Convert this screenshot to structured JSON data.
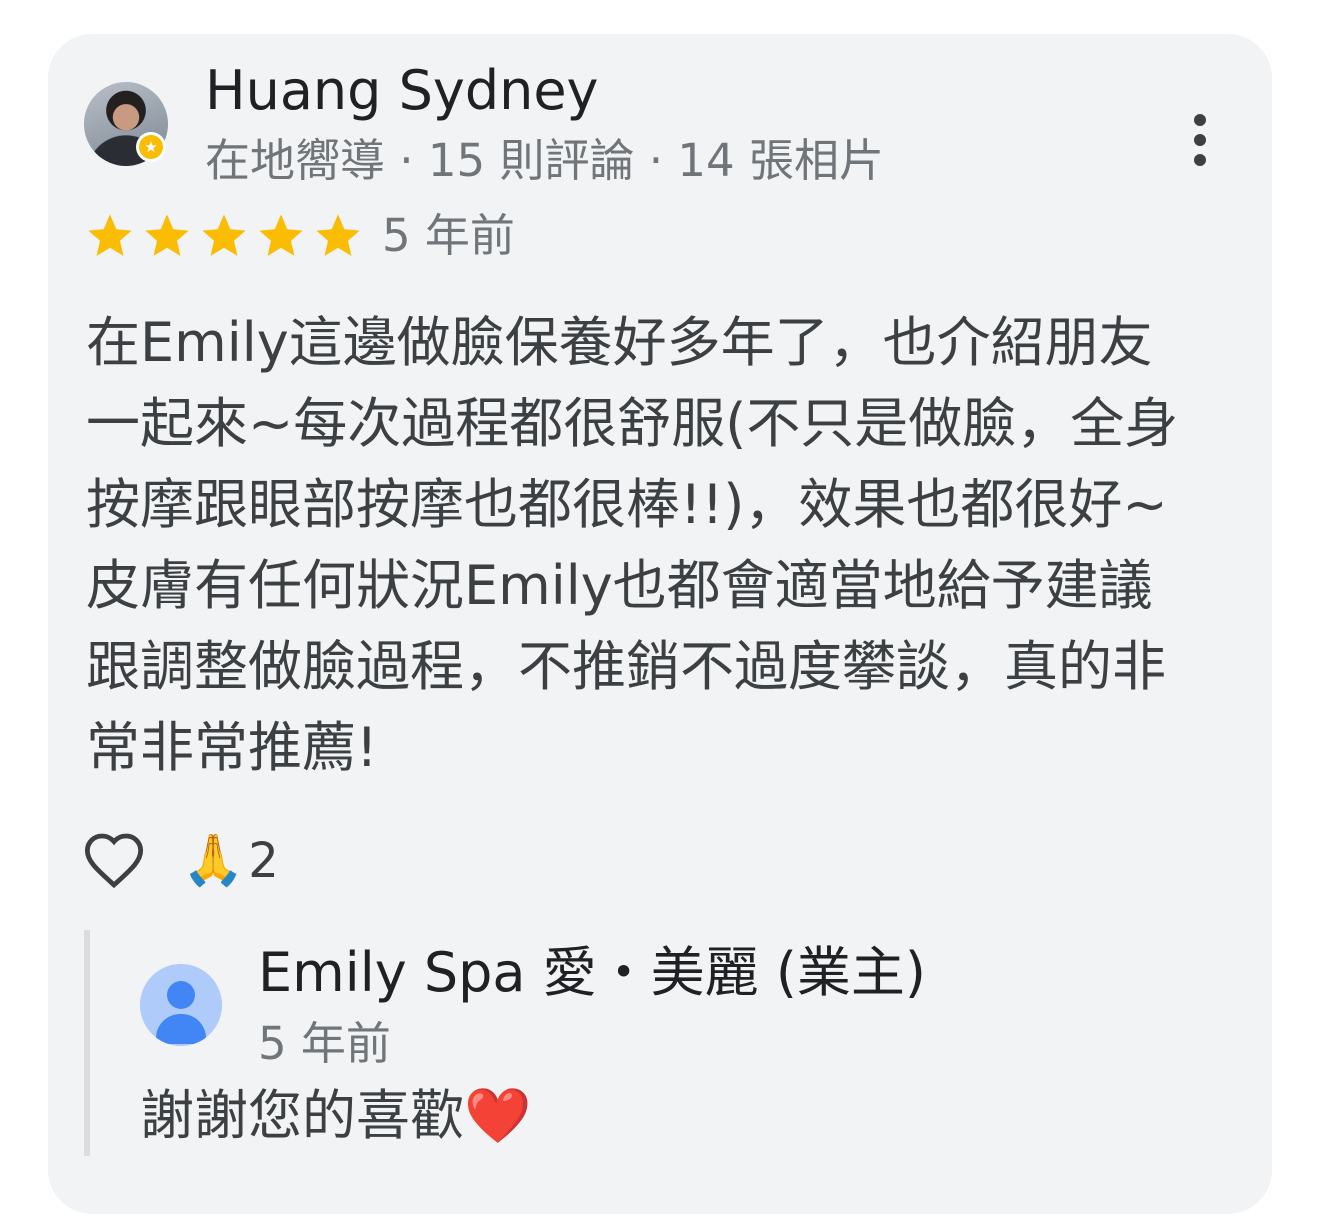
{
  "review": {
    "author": "Huang Sydney",
    "meta": "在地嚮導 · 15 則評論 · 14 張相片",
    "rating": 5,
    "time": "5 年前",
    "body_lines": [
      "在Emily這邊做臉保養好多年了，也介紹朋友",
      "一起來~每次過程都很舒服(不只是做臉，全身",
      "按摩跟眼部按摩也都很棒!!)，效果也都很好~",
      "皮膚有任何狀況Emily也都會適當地給予建議",
      "跟調整做臉過程，不推銷不過度攀談，真的非",
      "常非常推薦!"
    ],
    "reaction_emoji": "🙏",
    "reaction_count": "2"
  },
  "owner_reply": {
    "name": "Emily Spa 愛・美麗 (業主)",
    "time": "5 年前",
    "text": "謝謝您的喜歡❤️"
  },
  "icons": {
    "star_color": "#fbbc04",
    "local_guide_badge": "local-guide-badge-icon",
    "menu": "more-vert-icon",
    "like": "heart-outline-icon",
    "owner_avatar": "person-icon"
  }
}
